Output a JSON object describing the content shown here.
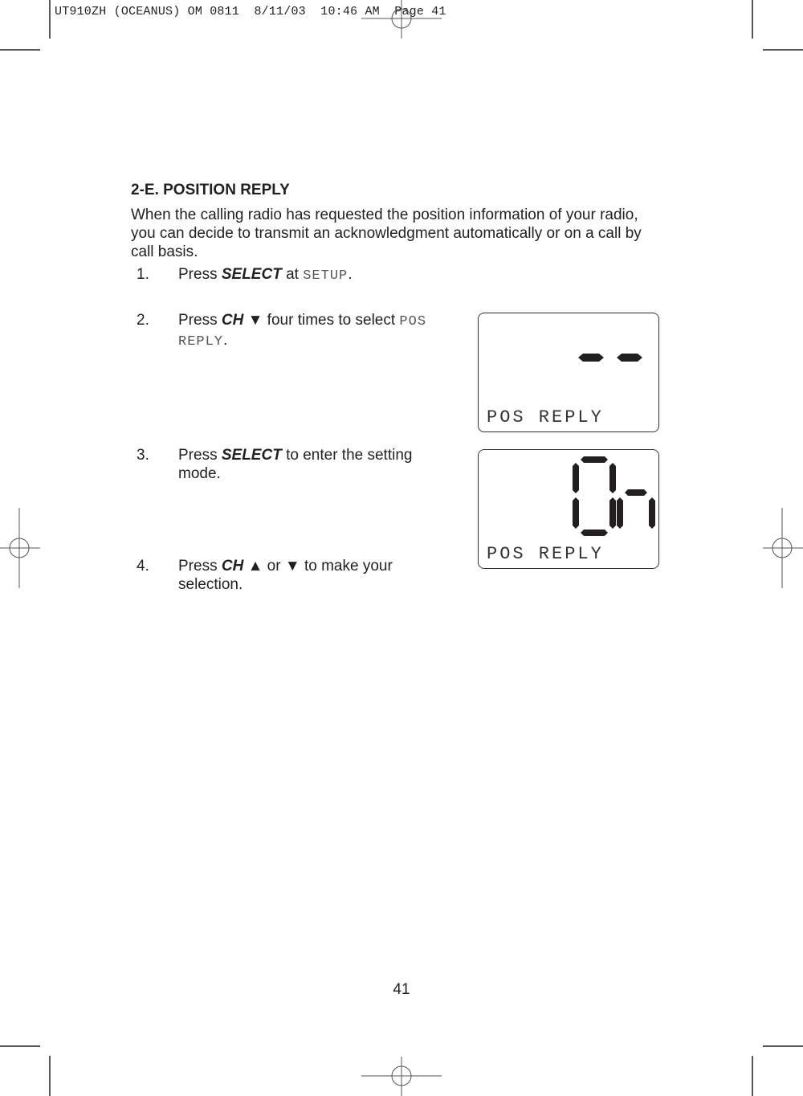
{
  "slug": "UT910ZH (OCEANUS) OM 0811  8/11/03  10:46 AM  Page 41",
  "section": {
    "heading": "2-E. POSITION REPLY",
    "intro": "When the calling radio has requested the position information of your radio, you can decide to transmit an acknowledgment automatically or on a call by call basis."
  },
  "steps": [
    {
      "num": "1.",
      "pre": "Press ",
      "key": "SELECT",
      "mid": " at ",
      "lcd": "SETUP",
      "post": "."
    },
    {
      "num": "2.",
      "pre": "Press ",
      "key": "CH",
      "arrow": "▼",
      "mid": " four times to select ",
      "lcd": "POS REPLY",
      "post": "."
    },
    {
      "num": "3.",
      "pre": "Press ",
      "key": "SELECT",
      "post": " to enter the setting mode."
    },
    {
      "num": "4.",
      "pre": "Press ",
      "key": "CH",
      "arrow_up": "▲",
      "mid": " or ",
      "arrow_down": "▼",
      "post": " to make your selection."
    }
  ],
  "displays": [
    {
      "main": "--",
      "label": "POS REPLY"
    },
    {
      "main": "On",
      "label": "POS REPLY"
    }
  ],
  "page_number": "41"
}
